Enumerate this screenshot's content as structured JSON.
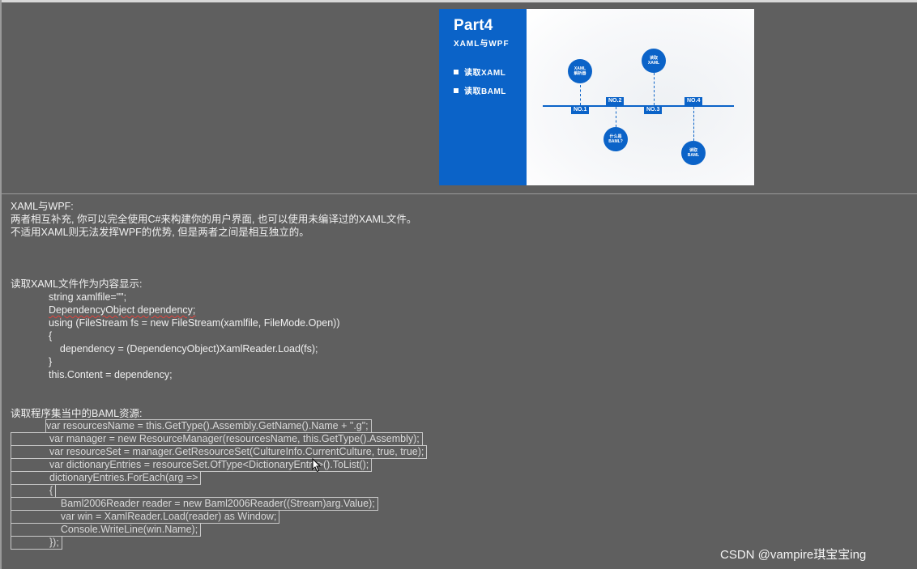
{
  "slide": {
    "part": "Part4",
    "subtitle": "XAML与WPF",
    "bullets": [
      "读取XAML",
      "读取BAML"
    ],
    "timeline": [
      "NO.1",
      "NO.2",
      "NO.3",
      "NO.4"
    ],
    "circles": [
      "XAML\n解析器",
      "什么是\nBAML?",
      "读取\nXAML",
      "读取\nBAML"
    ]
  },
  "notes": {
    "heading": "XAML与WPF:",
    "line1": "两者相互补充, 你可以完全使用C#来构建你的用户界面, 也可以使用未编译过的XAML文件。",
    "line2": "不适用XAML则无法发挥WPF的优势, 但是两者之间是相互独立的。",
    "section1_title": "读取XAML文件作为内容显示:",
    "code1": [
      "string xamlfile=\"\";",
      "DependencyObject dependency;",
      "using (FileStream fs = new FileStream(xamlfile, FileMode.Open))",
      "{",
      "    dependency = (DependencyObject)XamlReader.Load(fs);",
      "}",
      "this.Content = dependency;"
    ],
    "section2_title": "读取程序集当中的BAML资源:",
    "code2": [
      "var resourcesName = this.GetType().Assembly.GetName().Name + \".g\";",
      "var manager = new ResourceManager(resourcesName, this.GetType().Assembly);",
      "var resourceSet = manager.GetResourceSet(CultureInfo.CurrentCulture, true, true);",
      "var dictionaryEntries = resourceSet.OfType<DictionaryEntry>().ToList();",
      "dictionaryEntries.ForEach(arg =>",
      "{",
      "    Baml2006Reader reader = new Baml2006Reader((Stream)arg.Value);",
      "    var win = XamlReader.Load(reader) as Window;",
      "    Console.WriteLine(win.Name);",
      "});"
    ]
  },
  "watermark": "CSDN @vampire琪宝宝ing"
}
